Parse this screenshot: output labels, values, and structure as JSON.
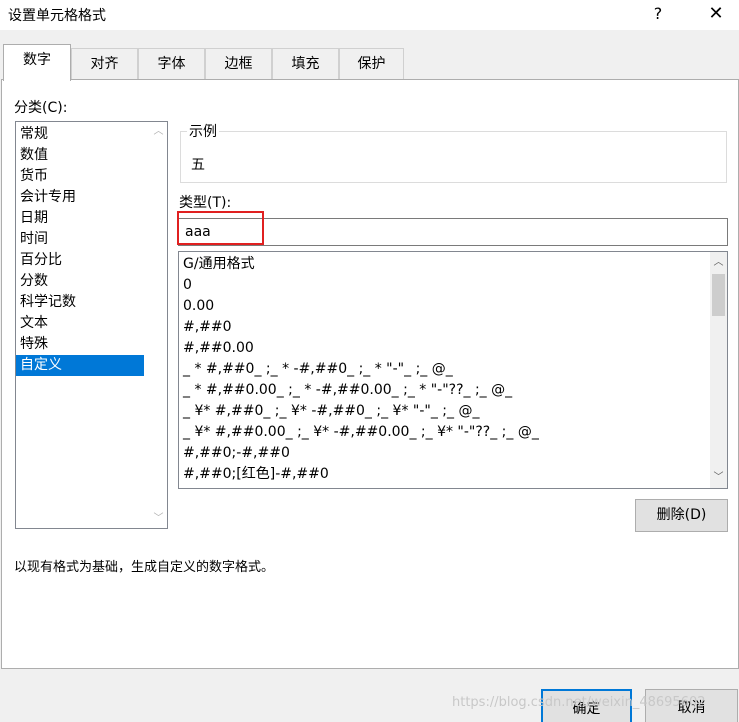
{
  "dialog": {
    "title": "设置单元格格式",
    "help_label": "?",
    "close_label": "✕"
  },
  "tabs": [
    {
      "label": "数字",
      "active": true
    },
    {
      "label": "对齐"
    },
    {
      "label": "字体"
    },
    {
      "label": "边框"
    },
    {
      "label": "填充"
    },
    {
      "label": "保护"
    }
  ],
  "category": {
    "label": "分类(C):",
    "items": [
      "常规",
      "数值",
      "货币",
      "会计专用",
      "日期",
      "时间",
      "百分比",
      "分数",
      "科学记数",
      "文本",
      "特殊",
      "自定义"
    ],
    "selected": "自定义"
  },
  "sample": {
    "label": "示例",
    "value": "五"
  },
  "type": {
    "label": "类型(T):",
    "value": "aaa",
    "formats": [
      "G/通用格式",
      "0",
      "0.00",
      "#,##0",
      "#,##0.00",
      "_ * #,##0_ ;_ * -#,##0_ ;_ * \"-\"_ ;_ @_",
      "_ * #,##0.00_ ;_ * -#,##0.00_ ;_ * \"-\"??_ ;_ @_",
      "_ ¥* #,##0_ ;_ ¥* -#,##0_ ;_ ¥* \"-\"_ ;_ @_",
      "_ ¥* #,##0.00_ ;_ ¥* -#,##0.00_ ;_ ¥* \"-\"??_ ;_ @_",
      "#,##0;-#,##0",
      "#,##0;[红色]-#,##0"
    ]
  },
  "buttons": {
    "delete": "删除(D)",
    "ok": "确定",
    "cancel": "取消"
  },
  "description": "以现有格式为基础，生成自定义的数字格式。",
  "watermark": "https://blog.csdn.net/weixin_48695602"
}
